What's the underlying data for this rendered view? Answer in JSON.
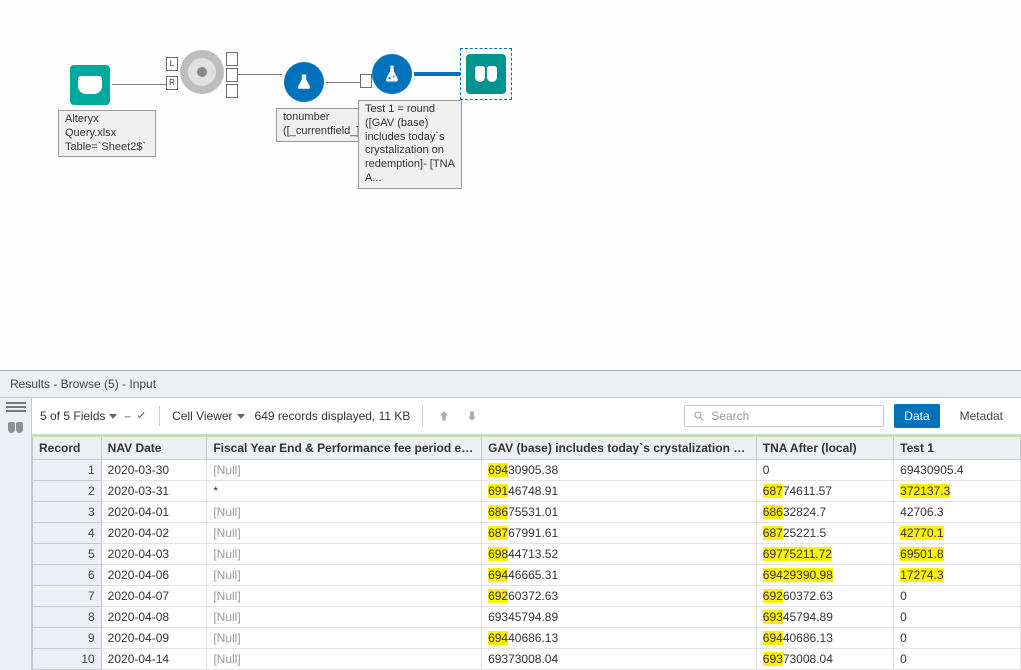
{
  "canvas": {
    "input_label": "Alteryx\nQuery.xlsx\nTable=`Sheet2$`",
    "multifield_label": "tonumber\n([_currentfield_]",
    "formula_label": "Test 1 = round\n([GAV (base)\nincludes today`s\ncrystalization on\nredemption]-\n[TNA A...",
    "anchor_L": "L",
    "anchor_R": "R"
  },
  "results": {
    "header": "Results - Browse (5) - Input",
    "fields_label": "5 of 5 Fields",
    "cellviewer_label": "Cell Viewer",
    "records_label": "649 records displayed, 11 KB",
    "search_placeholder": "Search",
    "tab_data": "Data",
    "tab_metadata": "Metadat",
    "columns": {
      "record": "Record",
      "navdate": "NAV Date",
      "fy": "Fiscal Year End & Performance fee period end",
      "gav": "GAV (base) includes today`s crystalization on...",
      "tna": "TNA After (local)",
      "test1": "Test 1"
    },
    "rows": [
      {
        "n": "1",
        "nav": "2020-03-30",
        "fy": "[Null]",
        "gav_a": "694",
        "gav_b": "30905.38",
        "tna_a": "0",
        "tna_b": "",
        "t1_a": "69430905.4",
        "t1_b": "",
        "hl_gav": 1,
        "hl_tna": 0,
        "hl_t1": 0
      },
      {
        "n": "2",
        "nav": "2020-03-31",
        "fy": "*",
        "gav_a": "691",
        "gav_b": "46748.91",
        "tna_a": "687",
        "tna_b": "74611.57",
        "t1_a": "372137.3",
        "t1_b": "",
        "hl_gav": 1,
        "hl_tna": 1,
        "hl_t1": 1
      },
      {
        "n": "3",
        "nav": "2020-04-01",
        "fy": "[Null]",
        "gav_a": "686",
        "gav_b": "75531.01",
        "tna_a": "686",
        "tna_b": "32824.7",
        "t1_a": "42706.3",
        "t1_b": "",
        "hl_gav": 1,
        "hl_tna": 1,
        "hl_t1": 0
      },
      {
        "n": "4",
        "nav": "2020-04-02",
        "fy": "[Null]",
        "gav_a": "687",
        "gav_b": "67991.61",
        "tna_a": "687",
        "tna_b": "25221.5",
        "t1_a": "42770.1",
        "t1_b": "",
        "hl_gav": 1,
        "hl_tna": 1,
        "hl_t1": 1
      },
      {
        "n": "5",
        "nav": "2020-04-03",
        "fy": "[Null]",
        "gav_a": "698",
        "gav_b": "44713.52",
        "tna_a": "69775211.72",
        "tna_b": "",
        "t1_a": "69501.8",
        "t1_b": "",
        "hl_gav": 1,
        "hl_tna": 2,
        "hl_t1": 1
      },
      {
        "n": "6",
        "nav": "2020-04-06",
        "fy": "[Null]",
        "gav_a": "694",
        "gav_b": "46665.31",
        "tna_a": "69429390.98",
        "tna_b": "",
        "t1_a": "17274.3",
        "t1_b": "",
        "hl_gav": 1,
        "hl_tna": 2,
        "hl_t1": 1
      },
      {
        "n": "7",
        "nav": "2020-04-07",
        "fy": "[Null]",
        "gav_a": "692",
        "gav_b": "60372.63",
        "tna_a": "692",
        "tna_b": "60372.63",
        "t1_a": "0",
        "t1_b": "",
        "hl_gav": 1,
        "hl_tna": 1,
        "hl_t1": 0
      },
      {
        "n": "8",
        "nav": "2020-04-08",
        "fy": "[Null]",
        "gav_a": "69345794.89",
        "gav_b": "",
        "tna_a": "693",
        "tna_b": "45794.89",
        "t1_a": "0",
        "t1_b": "",
        "hl_gav": 0,
        "hl_tna": 1,
        "hl_t1": 0
      },
      {
        "n": "9",
        "nav": "2020-04-09",
        "fy": "[Null]",
        "gav_a": "694",
        "gav_b": "40686.13",
        "tna_a": "694",
        "tna_b": "40686.13",
        "t1_a": "0",
        "t1_b": "",
        "hl_gav": 1,
        "hl_tna": 1,
        "hl_t1": 0
      },
      {
        "n": "10",
        "nav": "2020-04-14",
        "fy": "[Null]",
        "gav_a": "69373008.04",
        "gav_b": "",
        "tna_a": "693",
        "tna_b": "73008.04",
        "t1_a": "0",
        "t1_b": "",
        "hl_gav": 0,
        "hl_tna": 1,
        "hl_t1": 0
      }
    ]
  }
}
